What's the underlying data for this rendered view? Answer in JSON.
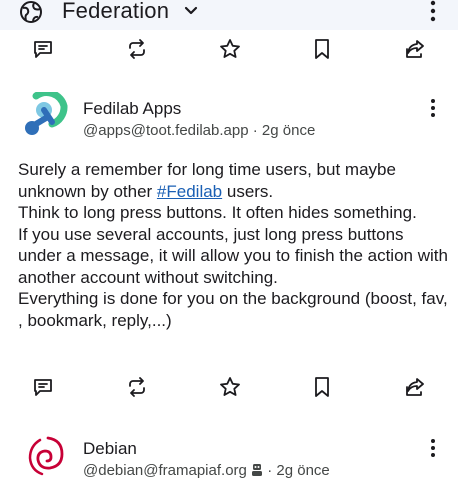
{
  "header": {
    "title": "Federation",
    "icons": [
      "globe-icon",
      "chevron-down-icon",
      "more-vert-icon"
    ]
  },
  "action_icons": [
    "reply-icon",
    "boost-icon",
    "favourite-icon",
    "bookmark-icon",
    "share-icon"
  ],
  "posts": [
    {
      "name": "Fedilab Apps",
      "handle": "@apps@toot.fedilab.app",
      "time": "2g önce",
      "content": {
        "line1_before": "Surely a remember for long time users, but maybe unknown by other ",
        "hashtag": "#Fedilab",
        "line1_after": " users.",
        "p2": "Think to long press buttons. It often hides something.",
        "p3": "If you use several accounts, just long press buttons under a message, it will allow you to finish the action with another account without switching.",
        "p4": "Everything is done for you on the background (boost, fav, , bookmark, reply,...)"
      }
    },
    {
      "name": "Debian",
      "handle": "@debian@framapiaf.org",
      "time": "2g önce",
      "badge_icon": "robot-icon"
    }
  ],
  "colors": {
    "topbar_bg": "#f3f6fb",
    "text": "#1c1b1f",
    "secondary_text": "#444746",
    "link": "#1a5fb4",
    "fedilab_green": "#3ec38a",
    "fedilab_blue": "#2f6fb8",
    "debian_red": "#c70036"
  }
}
